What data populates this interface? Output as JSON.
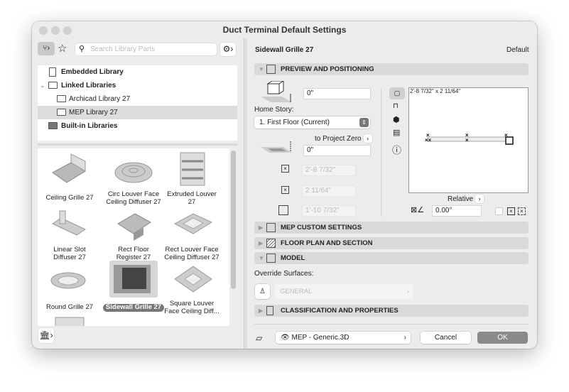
{
  "window": {
    "title": "Duct Terminal Default Settings"
  },
  "left": {
    "search_placeholder": "Search Library Parts",
    "tree": [
      {
        "label": "Embedded Library",
        "bold": true
      },
      {
        "label": "Linked Libraries",
        "bold": true,
        "expanded": true
      },
      {
        "label": "Archicad Library 27",
        "bold": false
      },
      {
        "label": "MEP Library 27",
        "bold": false,
        "selected": true
      },
      {
        "label": "Built-in Libraries",
        "bold": true
      }
    ],
    "items": [
      {
        "l1": "Ceiling Grille 27",
        "l2": ""
      },
      {
        "l1": "Circ Louver Face",
        "l2": "Ceiling Diffuser 27"
      },
      {
        "l1": "Extruded Louver",
        "l2": "27"
      },
      {
        "l1": "Linear Slot",
        "l2": "Diffuser 27"
      },
      {
        "l1": "Rect Floor",
        "l2": "Register 27"
      },
      {
        "l1": "Rect Louver Face",
        "l2": "Ceiling Diffuser 27"
      },
      {
        "l1": "Round Grille 27",
        "l2": ""
      },
      {
        "l1": "Sidewall Grille 27",
        "l2": "",
        "selected": true
      },
      {
        "l1": "Square Louver",
        "l2": "Face Ceiling Diff..."
      }
    ]
  },
  "right": {
    "header_title": "Sidewall Grille 27",
    "header_default": "Default",
    "sections": {
      "preview": "PREVIEW AND POSITIONING",
      "mep": "MEP CUSTOM SETTINGS",
      "floor": "FLOOR PLAN AND SECTION",
      "model": "MODEL",
      "classification": "CLASSIFICATION AND PROPERTIES"
    },
    "elevation_value": "0\"",
    "home_story_label": "Home Story:",
    "home_story_value": "1. First Floor (Current)",
    "to_project_zero": "to Project Zero",
    "project_zero_value": "0\"",
    "width_value": "2'-8 7/32\"",
    "depth_value": "2 11/64\"",
    "height_value": "1'-10 7/32\"",
    "preview_dims": "2'-8 7/32\" x 2 11/64\"",
    "relative_label": "Relative",
    "angle_value": "0.00°",
    "override_label": "Override Surfaces:",
    "surface_value": "GENERAL",
    "layer_value": "MEP - Generic.3D",
    "cancel": "Cancel",
    "ok": "OK"
  }
}
